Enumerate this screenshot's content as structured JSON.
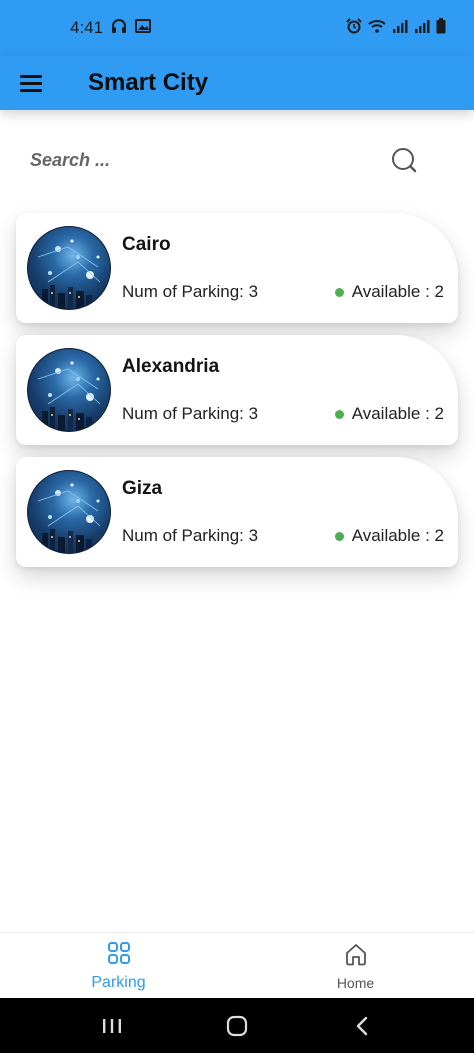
{
  "status_bar": {
    "time": "4:41"
  },
  "app_bar": {
    "title": "Smart City",
    "menu_icon": "hamburger-menu-icon"
  },
  "search": {
    "placeholder": "Search ...",
    "value": "",
    "icon": "search-icon"
  },
  "cities": [
    {
      "name": "Cairo",
      "num_parking_text": "Num of Parking: 3",
      "available_text": "Available : 2"
    },
    {
      "name": "Alexandria",
      "num_parking_text": "Num of Parking: 3",
      "available_text": "Available : 2"
    },
    {
      "name": "Giza",
      "num_parking_text": "Num of Parking: 3",
      "available_text": "Available : 2"
    }
  ],
  "bottom_nav": {
    "items": [
      {
        "label": "Parking",
        "icon": "grid-icon",
        "active": true
      },
      {
        "label": "Home",
        "icon": "home-icon",
        "active": false
      }
    ]
  },
  "colors": {
    "primary": "#2f9bf3",
    "available_dot": "#4caf50",
    "active_nav": "#2f9bf3"
  }
}
